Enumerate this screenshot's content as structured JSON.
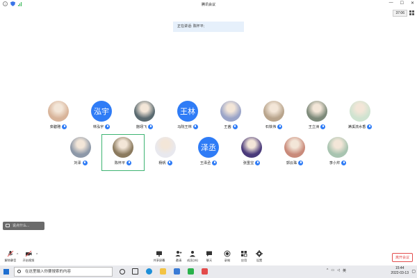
{
  "window": {
    "title": "腾讯会议"
  },
  "timer": "37:06",
  "speaking_text": "正在讲话: 陈怀平;",
  "participants": [
    {
      "name": "栾碧雅",
      "kind": "photo",
      "bg": "#d8b49a"
    },
    {
      "name": "林泓宇",
      "kind": "initials",
      "initials": "泓宇"
    },
    {
      "name": "施翊飞",
      "kind": "photo",
      "bg": "#5a6a70"
    },
    {
      "name": "马院王林",
      "kind": "initials",
      "initials": "王林"
    },
    {
      "name": "王茜",
      "kind": "photo",
      "bg": "#9aa4c8"
    },
    {
      "name": "石铁伟",
      "kind": "photo",
      "bg": "#b8a48c"
    },
    {
      "name": "王立洲",
      "kind": "photo",
      "bg": "#7d8a7a"
    },
    {
      "name": "满溪流水香",
      "kind": "photo",
      "bg": "#cfe3d0"
    },
    {
      "name": "刘泽",
      "kind": "photo",
      "bg": "#8d98a8"
    },
    {
      "name": "陈怀平",
      "kind": "photo",
      "bg": "#8b7a5e"
    },
    {
      "name": "杨帆",
      "kind": "photo",
      "bg": "#e8e8ee"
    },
    {
      "name": "王泽丞",
      "kind": "initials",
      "initials": "泽丞"
    },
    {
      "name": "张虽宝",
      "kind": "photo",
      "bg": "#4a3a7a"
    },
    {
      "name": "郭云珠",
      "kind": "photo",
      "bg": "#c98a7a"
    },
    {
      "name": "李小芹",
      "kind": "photo",
      "bg": "#a8c4b0"
    }
  ],
  "chat_placeholder": "说点什么...",
  "toolbar": {
    "mute": "解除静音",
    "video": "开启视频",
    "share": "共享屏幕",
    "invite": "邀请",
    "members": "成员(15)",
    "chat": "聊天",
    "record": "录制",
    "apps": "应用",
    "settings": "设置",
    "leave": "离开会议"
  },
  "taskbar": {
    "search_placeholder": "在这里输入你要搜索的内容",
    "time": "15:44",
    "date": "2022-03-13",
    "ime": "英"
  },
  "colors": {
    "accent": "#2f7cf6",
    "leave": "#e34b4b",
    "active_border": "#3cb371"
  }
}
